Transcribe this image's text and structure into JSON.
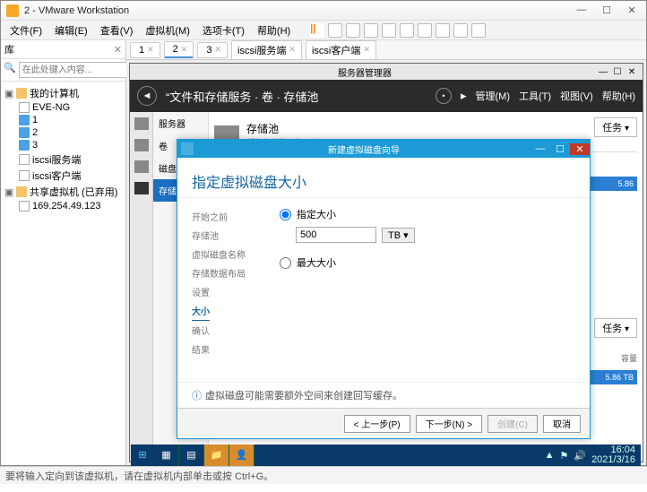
{
  "window": {
    "title": "2 - VMware Workstation"
  },
  "menubar": {
    "file": "文件(F)",
    "edit": "编辑(E)",
    "view": "查看(V)",
    "vm": "虚拟机(M)",
    "tabs": "选项卡(T)",
    "help": "帮助(H)"
  },
  "library": {
    "label": "库",
    "search_placeholder": "在此处键入内容...",
    "root": "我的计算机",
    "items": [
      "EVE-NG",
      "1",
      "2",
      "3",
      "iscsi服务端",
      "iscsi客户端"
    ],
    "shared": "共享虚拟机 (已弃用)",
    "ip": "169.254.49.123"
  },
  "vmtabs": {
    "t1": "1",
    "t2": "2",
    "t3": "3",
    "t4": "iscsi服务端",
    "t5": "iscsi客户端"
  },
  "srvmgr": {
    "title": "服务器管理器",
    "breadcrumb": "“文件和存储服务 · 卷 · 存储池",
    "menu": {
      "manage": "管理(M)",
      "tools": "工具(T)",
      "view": "视图(V)",
      "help": "帮助(H)"
    },
    "nav": {
      "servers": "服务器",
      "volumes": "卷",
      "disks": "磁盘",
      "pools": "存储池"
    },
    "pool_title": "存储池",
    "pool_sub": "所有存储池 | 共 1 个",
    "task": "任务",
    "cap": "容量",
    "val1": "5.86",
    "val2": "5.86 TB"
  },
  "wizard": {
    "title": "新建虚拟磁盘向导",
    "heading": "指定虚拟磁盘大小",
    "steps": {
      "before": "开始之前",
      "pool": "存储池",
      "name": "虚拟磁盘名称",
      "layout": "存储数据布局",
      "settings": "设置",
      "size": "大小",
      "confirm": "确认",
      "result": "结果"
    },
    "fixed_label": "指定大小",
    "size_value": "500",
    "unit": "TB",
    "max_label": "最大大小",
    "note": "虚拟磁盘可能需要额外空间来创建回写缓存。",
    "buttons": {
      "prev": "< 上一步(P)",
      "next": "下一步(N) >",
      "create": "创建(C)",
      "cancel": "取消"
    }
  },
  "taskbar": {
    "time": "16:04",
    "date": "2021/3/16"
  },
  "statusbar": {
    "text": "要将输入定向到该虚拟机，请在虚拟机内部单击或按 Ctrl+G。"
  }
}
